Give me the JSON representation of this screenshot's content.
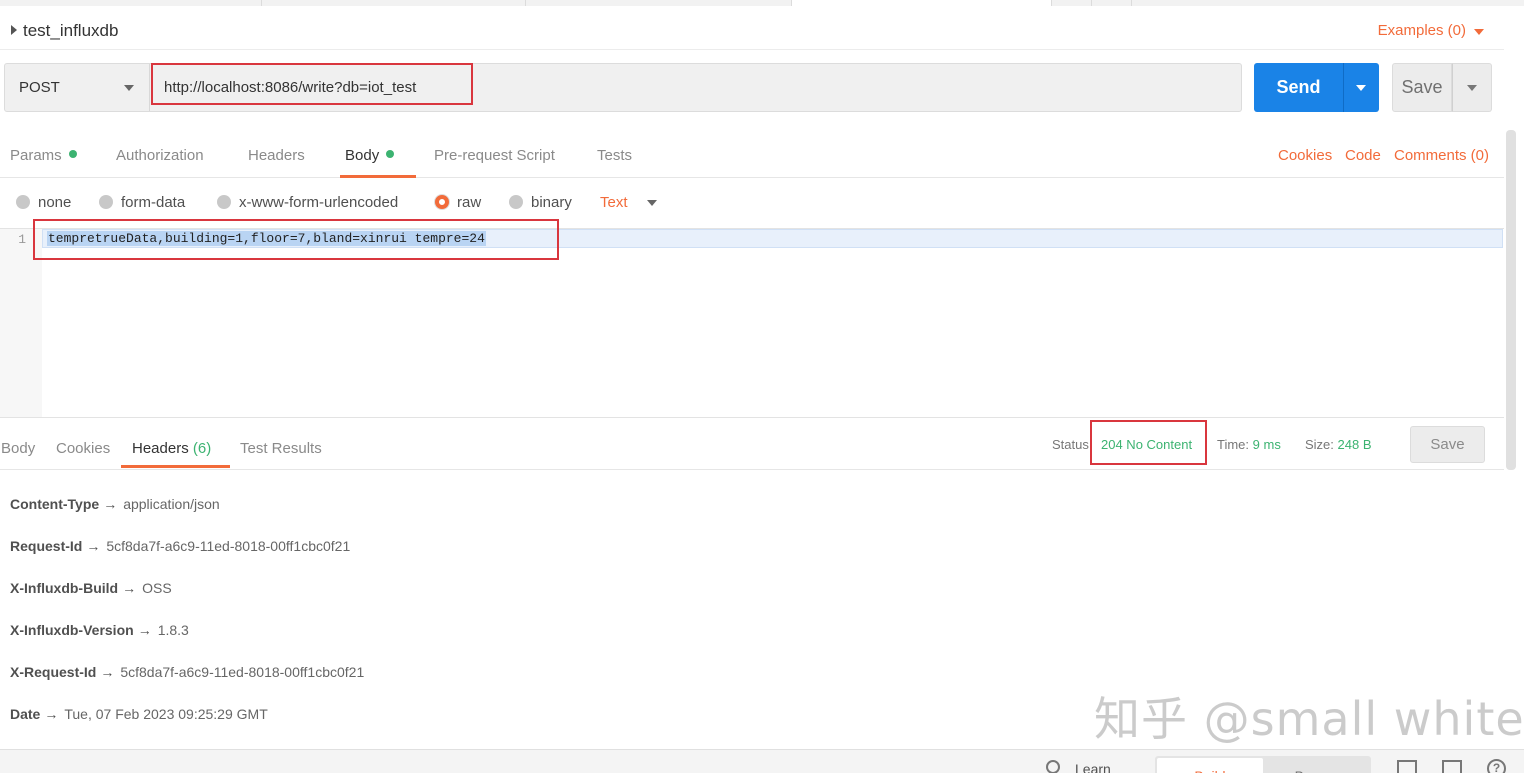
{
  "request": {
    "name": "test_influxdb",
    "examples_label": "Examples (0)",
    "method": "POST",
    "url": "http://localhost:8086/write?db=iot_test",
    "send_label": "Send",
    "save_label": "Save"
  },
  "request_tabs": {
    "params": "Params",
    "authorization": "Authorization",
    "headers": "Headers",
    "body": "Body",
    "prerequest": "Pre-request Script",
    "tests": "Tests",
    "cookies": "Cookies",
    "code": "Code",
    "comments": "Comments (0)"
  },
  "body_types": {
    "none": "none",
    "form_data": "form-data",
    "urlencoded": "x-www-form-urlencoded",
    "raw": "raw",
    "binary": "binary",
    "text_format": "Text",
    "selected": "raw"
  },
  "editor": {
    "line_number": "1",
    "code": "tempretrueData,building=1,floor=7,bland=xinrui tempre=24"
  },
  "response_tabs": {
    "body": "Body",
    "cookies": "Cookies",
    "headers": "Headers",
    "headers_count": "(6)",
    "test_results": "Test Results"
  },
  "response_status": {
    "status_label": "Status:",
    "status_value": "204 No Content",
    "time_label": "Time:",
    "time_value": "9 ms",
    "size_label": "Size:",
    "size_value": "248 B",
    "save_label": "Save"
  },
  "response_headers": [
    {
      "key": "Content-Type",
      "value": "application/json"
    },
    {
      "key": "Request-Id",
      "value": "5cf8da7f-a6c9-11ed-8018-00ff1cbc0f21"
    },
    {
      "key": "X-Influxdb-Build",
      "value": "OSS"
    },
    {
      "key": "X-Influxdb-Version",
      "value": "1.8.3"
    },
    {
      "key": "X-Request-Id",
      "value": "5cf8da7f-a6c9-11ed-8018-00ff1cbc0f21"
    },
    {
      "key": "Date",
      "value": "Tue, 07 Feb 2023 09:25:29 GMT"
    }
  ],
  "arrow": "→",
  "watermark": "知乎 @small white",
  "status_bar": {
    "learn": "Learn",
    "build": "Build",
    "browse": "Browse",
    "help": "?"
  },
  "colors": {
    "accent": "#f26b3a",
    "send": "#1a83e7",
    "success": "#3cb371",
    "highlight": "#d9363e"
  }
}
